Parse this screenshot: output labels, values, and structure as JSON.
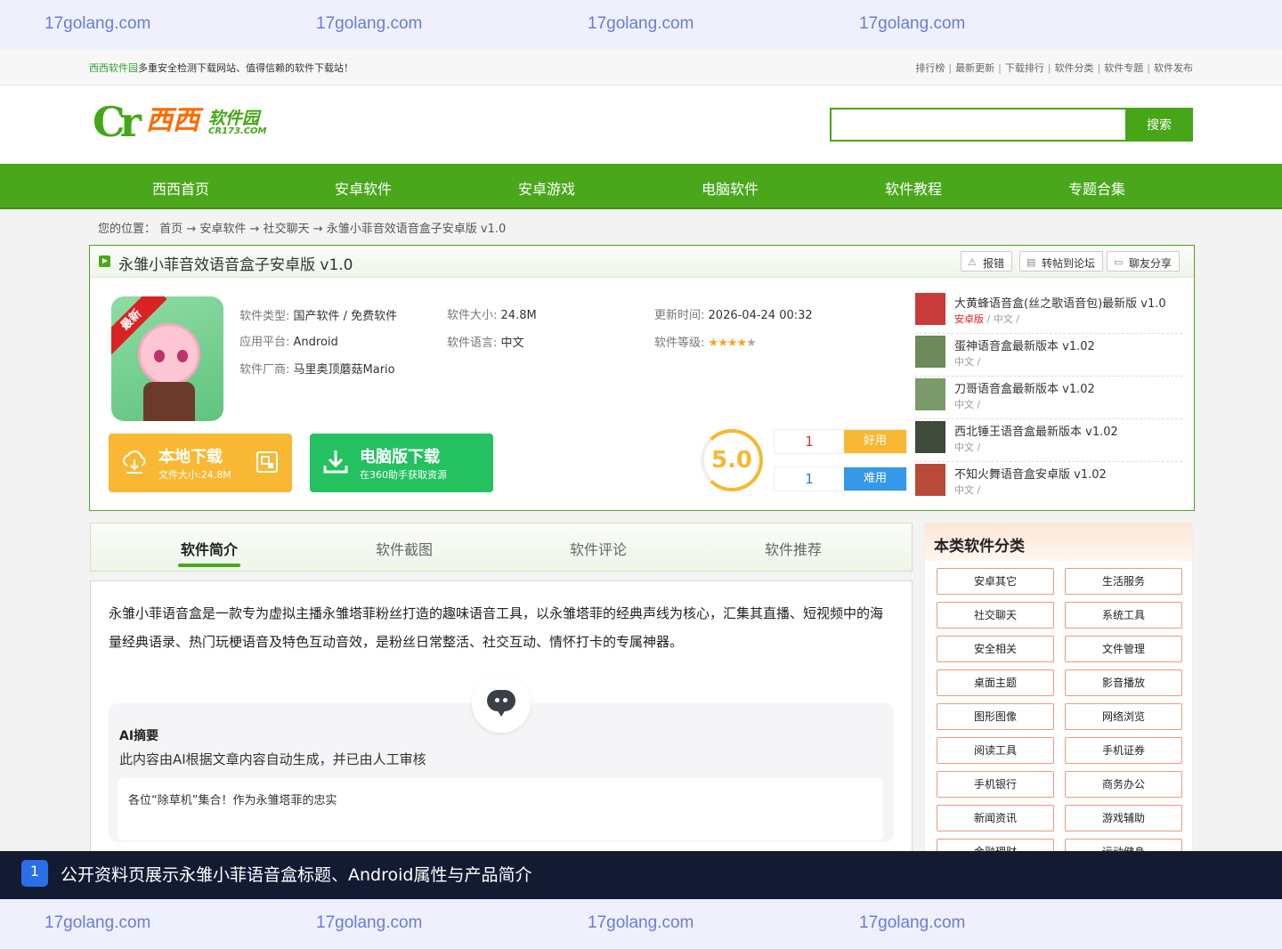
{
  "watermark": "17golang.com",
  "notice": {
    "brand": "西西软件园",
    "text": "多重安全检测下载网站、值得信赖的软件下载站！",
    "links": [
      "排行榜",
      "最新更新",
      "下载排行",
      "软件分类",
      "软件专题",
      "软件发布"
    ]
  },
  "logo": {
    "cr": "Cr",
    "cn": "西西",
    "sub": "软件园",
    "domain": "CR173.COM"
  },
  "search": {
    "value": "",
    "button": "搜索"
  },
  "nav": [
    "西西首页",
    "安卓软件",
    "安卓游戏",
    "电脑软件",
    "软件教程",
    "专题合集"
  ],
  "breadcrumb": {
    "prefix": "您的位置：",
    "items": [
      "首页",
      "安卓软件",
      "社交聊天",
      "永雏小菲音效语音盒子安卓版 v1.0"
    ],
    "sep": "→"
  },
  "app": {
    "title": "永雏小菲音效语音盒子安卓版  v1.0",
    "actions": [
      "报错",
      "转帖到论坛",
      "聊友分享"
    ],
    "ribbon": "最新",
    "type_label": "软件类型:",
    "type": "国产软件 / 免费软件",
    "size_label": "软件大小:",
    "size": "24.8M",
    "updated_label": "更新时间:",
    "updated": "2026-04-24 00:32",
    "platform_label": "应用平台:",
    "platform": "Android",
    "lang_label": "软件语言:",
    "lang": "中文",
    "level_label": "软件等级:",
    "rating_stars": 4,
    "vendor_label": "软件厂商:",
    "vendor": "马里奥顶蘑菇Mario",
    "score": "5.0",
    "good_count": "1",
    "good_label": "好用",
    "bad_count": "1",
    "bad_label": "难用"
  },
  "downloads": {
    "local_title": "本地下载",
    "local_sub": "文件大小:24.8M",
    "pc_title": "电脑版下载",
    "pc_sub": "在360助手获取资源"
  },
  "related": [
    {
      "title": "大黄蜂语音盒(丝之歌语音包)最新版 v1.0",
      "tag": "安卓版",
      "meta": "/ 中文 /"
    },
    {
      "title": "蛋神语音盒最新版本 v1.02",
      "tag": "",
      "meta": "中文 /"
    },
    {
      "title": "刀哥语音盒最新版本 v1.02",
      "tag": "",
      "meta": "中文 /"
    },
    {
      "title": "西北锤王语音盒最新版本 v1.02",
      "tag": "",
      "meta": "中文 /"
    },
    {
      "title": "不知火舞语音盒安卓版 v1.02",
      "tag": "",
      "meta": "中文 /"
    }
  ],
  "tabs": [
    "软件简介",
    "软件截图",
    "软件评论",
    "软件推荐"
  ],
  "intro": "永雏小菲语音盒是一款专为虚拟主播永雏塔菲粉丝打造的趣味语音工具，以永雏塔菲的经典声线为核心，汇集其直播、短视频中的海量经典语录、热门玩梗语音及特色互动音效，是粉丝日常整活、社交互动、情怀打卡的专属神器。",
  "ai": {
    "heading": "AI摘要",
    "desc": "此内容由AI根据文章内容自动生成，并已由人工审核",
    "quote": "各位“除草机”集合！作为永雏塔菲的忠实"
  },
  "sidebar": {
    "title": "本类软件分类",
    "categories": [
      "安卓其它",
      "生活服务",
      "社交聊天",
      "系统工具",
      "安全相关",
      "文件管理",
      "桌面主题",
      "影音播放",
      "图形图像",
      "网络浏览",
      "阅读工具",
      "手机证券",
      "手机银行",
      "商务办公",
      "新闻资讯",
      "游戏辅助",
      "金融理财",
      "运动健身"
    ]
  },
  "caption": {
    "num": "1",
    "text": "公开资料页展示永雏小菲语音盒标题、Android属性与产品简介"
  },
  "colors": {
    "green": "#4aa71c",
    "orange": "#f8b834",
    "pc_green": "#23c160",
    "blue": "#3598e8"
  }
}
